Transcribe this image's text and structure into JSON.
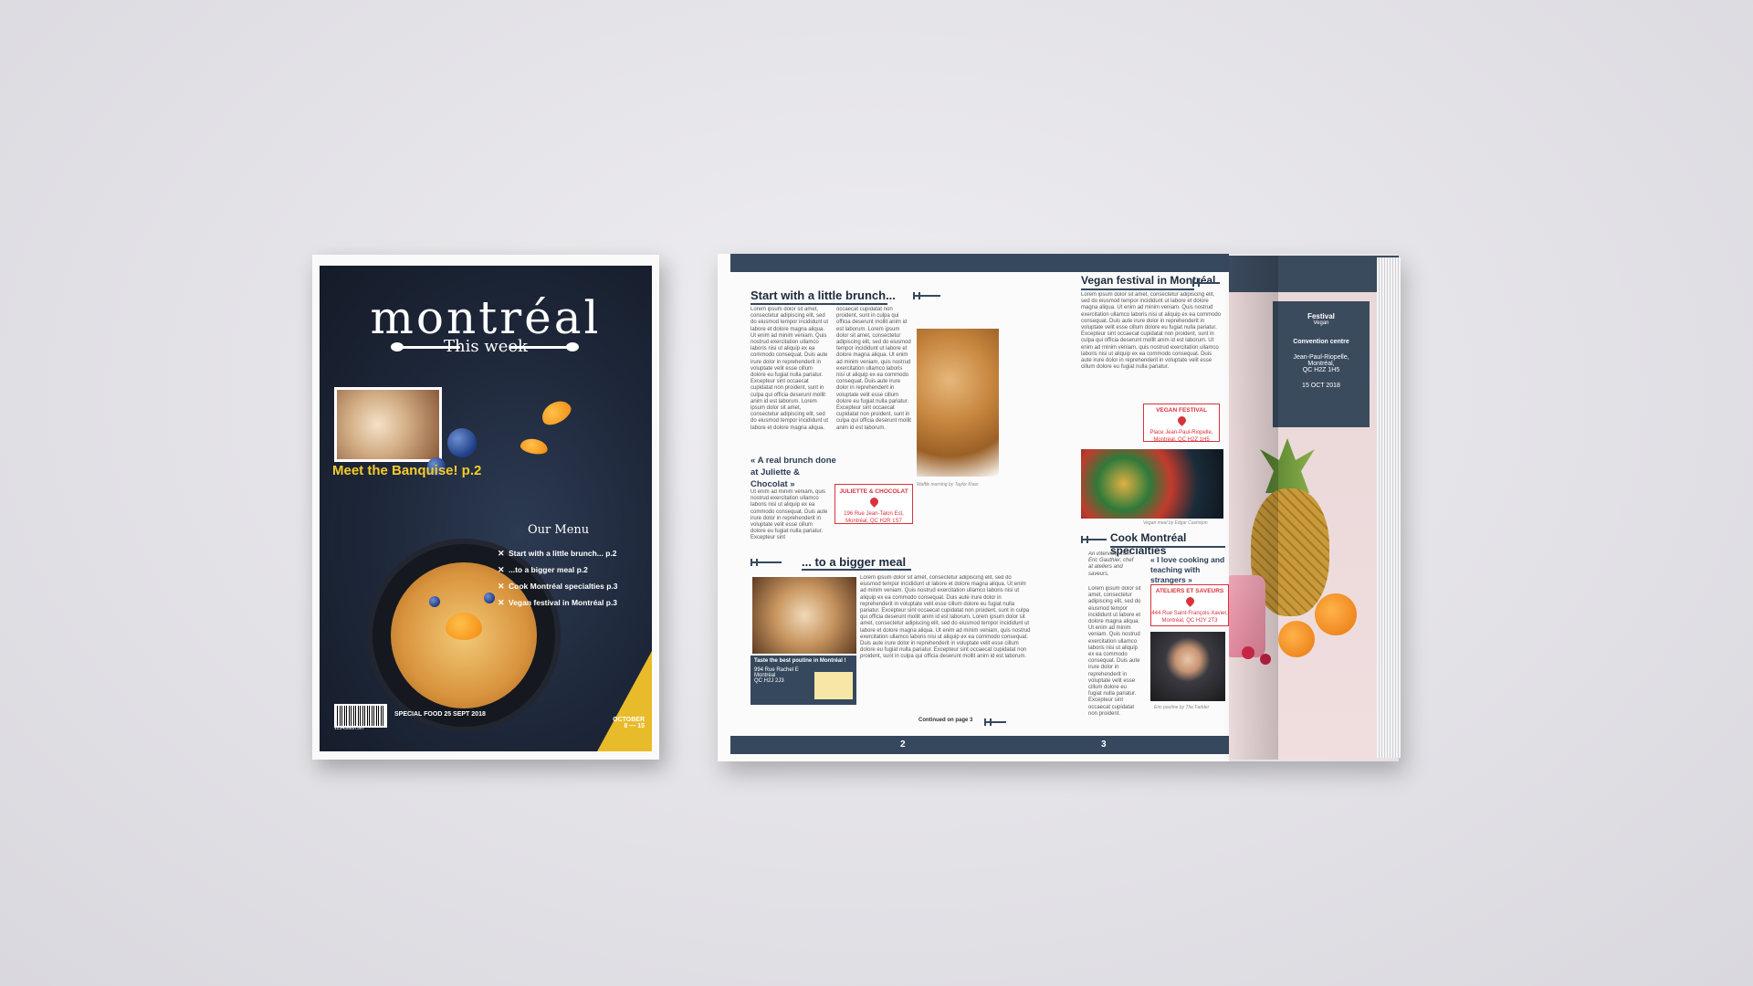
{
  "cover": {
    "masthead": "montréal",
    "subtitle": "This week",
    "feature": "Meet the Banquise! p.2",
    "menu_title": "Our Menu",
    "menu_items": [
      "Start with a little brunch... p.2",
      "...to a bigger meal p.2",
      "Cook Montréal specialties p.3",
      "Vegan festival in Montréal p.3"
    ],
    "barcode_number": "123456887567",
    "special": "SPECIAL FOOD 25 SEPT 2018",
    "month": "OCTOBER",
    "dates": "8 — 15"
  },
  "page2": {
    "title1": "Start with a little brunch...",
    "col1": "Lorem ipsum dolor sit amet, consectetur adipiscing elit, sed do eiusmod tempor incididunt ut labore et dolore magna aliqua. Ut enim ad minim veniam. Quis nostrud exercitation ullamco laboris nisi ut aliquip ex ea commodo consequat. Duis aute irure dolor in reprehenderit in voluptate velit esse cillum dolore eu fugiat nulla pariatur. Excepteur sint occaecat cupidatat non proident, sunt in culpa qui officia deserunt mollit anim id est laborum. Lorem ipsum dolor sit amet, consectetur adipiscing elit, sed do eiusmod tempor incididunt ut labore et dolore magna aliqua.",
    "col2": "occaecat cupidatat non proident, sunt in culpa qui officia deserunt mollit anim id est laborum. Lorem ipsum dolor sit amet, consectetur adipiscing elit, sed do eiusmod tempor incididunt ut labore et dolore magna aliqua. Ut enim ad minim veniam, quis nostrud exercitation ullamco laboris nisi ut aliquip ex ea commodo consequat. Duis aute irure dolor in reprehenderit in voluptate velit esse cillum dolore eu fugiat nulla pariatur. Excepteur sint occaecat cupidatat non proident, sunt in culpa qui officia deserunt mollit anim id est laborum.",
    "quote1": "« A real brunch done at Juliette & Chocolat »",
    "col1b": "Ut enim ad minim veniam, quis nostrud exercitation ullamco laboris nisi ut aliquip ex ea commodo consequat. Duis aute irure dolor in reprehenderit in voluptate velit esse cillum dolore eu fugiat nulla pariatur. Excepteur sint",
    "addr1_name": "JULIETTE & CHOCOLAT",
    "addr1_line": "196 Rue Jean-Talon Est, Montréal, QC H2R 1S7",
    "photo1_caption": "Waffle morning by Taylor Kiser",
    "title2": "... to a bigger meal",
    "col3": "Lorem ipsum dolor sit amet, consectetur adipiscing elit, sed do eiusmod tempor incididunt ut labore et dolore magna aliqua. Ut enim ad minim veniam. Quis nostrud exercitation ullamco laboris nisi ut aliquip ex ea commodo consequat. Duis aute irure dolor in reprehenderit in voluptate velit esse cillum dolore eu fugiat nulla pariatur. Excepteur sint occaecat cupidatat non proident, sunt in culpa qui officia deserunt mollit anim id est laborum. Lorem ipsum dolor sit amet, consectetur adipiscing elit, sed do eiusmod tempor incididunt ut labore et dolore magna aliqua. Ut enim ad minim veniam, quis nostrud exercitation ullamco laboris nisi ut aliquip ex ea commodo consequat. Duis aute irure dolor in reprehenderit in voluptate velit esse cillum dolore eu fugiat nulla pariatur. Excepteur sint occaecat cupidatat non proident, sunt in culpa qui officia deserunt mollit anim id est laborum.",
    "poutine_title": "Taste the best poutine in Montréal !",
    "poutine_addr1": "994 Rue Rachel E",
    "poutine_addr2": "Montréal",
    "poutine_addr3": "QC H2J 2J3",
    "continued": "Continued on page 3",
    "page_number": "2"
  },
  "page3": {
    "title1": "Vegan festival in Montréal",
    "text1": "Lorem ipsum dolor sit amet, consectetur adipiscing elit, sed do eiusmod tempor incididunt ut labore et dolore magna aliqua. Ut enim ad minim veniam. Quis nostrud exercitation ullamco laboris nisi ut aliquip ex ea commodo consequat. Duis aute irure dolor in reprehenderit in voluptate velit esse cillum dolore eu fugiat nulla pariatur. Excepteur sint occaecat cupidatat non proident, sunt in culpa qui officia deserunt mollit anim id est laborum. Ut enim ad minim veniam, quis nostrud exercitation ullamco laboris nisi ut aliquip ex ea commodo consequat. Duis aute irure dolor in reprehenderit in voluptate velit esse cillum dolore eu fugiat nulla pariatur.",
    "addr_name": "VEGAN FESTIVAL",
    "addr_line": "Place Jean-Paul-Riopelle, Montréal, QC H2Z 1H5",
    "photo_caption": "Vegan meal by Edgar Castrejon",
    "title2": "Cook Montréal specialties",
    "intro": "An interview from Eric Gauthier, chef at ateliers and saveurs.",
    "text2": "Lorem ipsum dolor sit amet, consectetur adipiscing elit, sed do eiusmod tempor incididunt ut labore et dolore magna aliqua. Ut enim ad minim veniam. Quis nostrud exercitation ullamco laboris nisi ut aliquip ex ea commodo consequat. Duis aute irure dolor in reprehenderit in voluptate velit esse cillum dolore eu fugiat nulla pariatur. Excepteur sint occaecat cupidatat non proident.",
    "quote": "« I love cooking and teaching with strangers »",
    "addr2_name": "ATELIERS ET SAVEURS",
    "addr2_line": "444 Rue Saint-François-Xavier, Montréal, QC H2Y 2T3",
    "chef_caption": "Eric poutine by The Fadder",
    "page_number": "3"
  },
  "backpage": {
    "fest_title": "Festival",
    "fest_sub": "Vegan",
    "venue": "Convention centre",
    "address1": "Jean-Paul-Riopelle,",
    "address2": "Montréal,",
    "address3": "QC H2Z 1H5",
    "date": "15 OCT 2018"
  }
}
